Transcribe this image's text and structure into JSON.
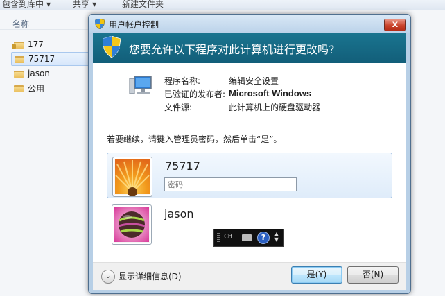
{
  "explorer": {
    "toolbar": {
      "include_in_library": "包含到库中",
      "share": "共享",
      "new_folder": "新建文件夹"
    },
    "column_header": "名称",
    "files": [
      {
        "name": "177",
        "icon": "locked-folder-icon",
        "selected": false
      },
      {
        "name": "75717",
        "icon": "folder-icon",
        "selected": true
      },
      {
        "name": "jason",
        "icon": "folder-icon",
        "selected": false
      },
      {
        "name": "公用",
        "icon": "folder-icon",
        "selected": false
      }
    ]
  },
  "dialog": {
    "title": "用户帐户控制",
    "close_label": "x",
    "header": "您要允许以下程序对此计算机进行更改吗?",
    "program": {
      "name_label": "程序名称:",
      "name_value": "编辑安全设置",
      "publisher_label": "已验证的发布者:",
      "publisher_value": "Microsoft Windows",
      "source_label": "文件源:",
      "source_value": "此计算机上的硬盘驱动器"
    },
    "instruction": "若要继续，请键入管理员密码，然后单击“是”。",
    "accounts": [
      {
        "username": "75717",
        "password_placeholder": "密码",
        "selected": true,
        "avatar": "orange-flower"
      },
      {
        "username": "jason",
        "selected": false,
        "avatar": "striped-ball"
      }
    ],
    "ime_bar": {
      "language": "CH",
      "keyboard": "keyboard-icon",
      "help": "?",
      "options": "options-icon"
    },
    "footer": {
      "details_label": "显示详细信息(D)",
      "yes_label": "是(Y)",
      "no_label": "否(N)"
    }
  },
  "colors": {
    "header_band": "#1a7590",
    "dialog_frame": "#b7cfe6",
    "selected_tile": "#dfecfa",
    "close_button": "#c9432b"
  }
}
